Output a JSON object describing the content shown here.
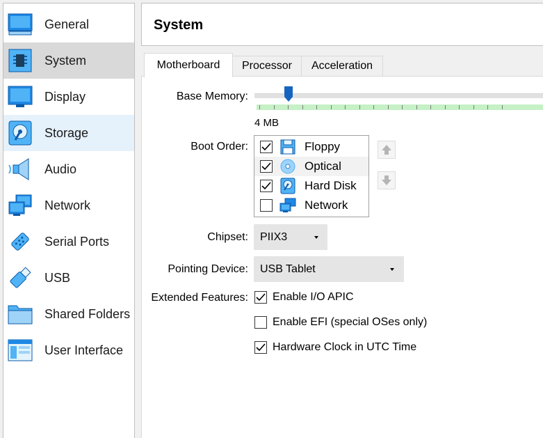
{
  "sidebar": {
    "items": [
      {
        "label": "General",
        "icon": "general-icon"
      },
      {
        "label": "System",
        "icon": "system-icon"
      },
      {
        "label": "Display",
        "icon": "display-icon"
      },
      {
        "label": "Storage",
        "icon": "storage-icon"
      },
      {
        "label": "Audio",
        "icon": "audio-icon"
      },
      {
        "label": "Network",
        "icon": "network-icon"
      },
      {
        "label": "Serial Ports",
        "icon": "serial-ports-icon"
      },
      {
        "label": "USB",
        "icon": "usb-icon"
      },
      {
        "label": "Shared Folders",
        "icon": "shared-folders-icon"
      },
      {
        "label": "User Interface",
        "icon": "user-interface-icon"
      }
    ],
    "selected": "System"
  },
  "header": {
    "title": "System"
  },
  "tabs": [
    {
      "label": "Motherboard",
      "active": true
    },
    {
      "label": "Processor",
      "active": false
    },
    {
      "label": "Acceleration",
      "active": false
    }
  ],
  "motherboard": {
    "base_memory": {
      "label": "Base Memory:",
      "value_label": "4 MB"
    },
    "boot_order": {
      "label": "Boot Order:",
      "items": [
        {
          "label": "Floppy",
          "checked": true,
          "icon": "floppy-icon"
        },
        {
          "label": "Optical",
          "checked": true,
          "icon": "optical-disc-icon"
        },
        {
          "label": "Hard Disk",
          "checked": true,
          "icon": "hard-disk-icon"
        },
        {
          "label": "Network",
          "checked": false,
          "icon": "network-icon"
        }
      ]
    },
    "chipset": {
      "label": "Chipset:",
      "value": "PIIX3"
    },
    "pointing_device": {
      "label": "Pointing Device:",
      "value": "USB Tablet"
    },
    "extended_features": {
      "label": "Extended Features:",
      "options": [
        {
          "label": "Enable I/O APIC",
          "checked": true
        },
        {
          "label": "Enable EFI (special OSes only)",
          "checked": false
        },
        {
          "label": "Hardware Clock in UTC Time",
          "checked": true
        }
      ]
    }
  },
  "colors": {
    "accent": "#1e88e5",
    "selected_bg": "#d9d9d9",
    "hover_bg": "#e5f1fb",
    "slider_green": "#c6f0c6"
  }
}
